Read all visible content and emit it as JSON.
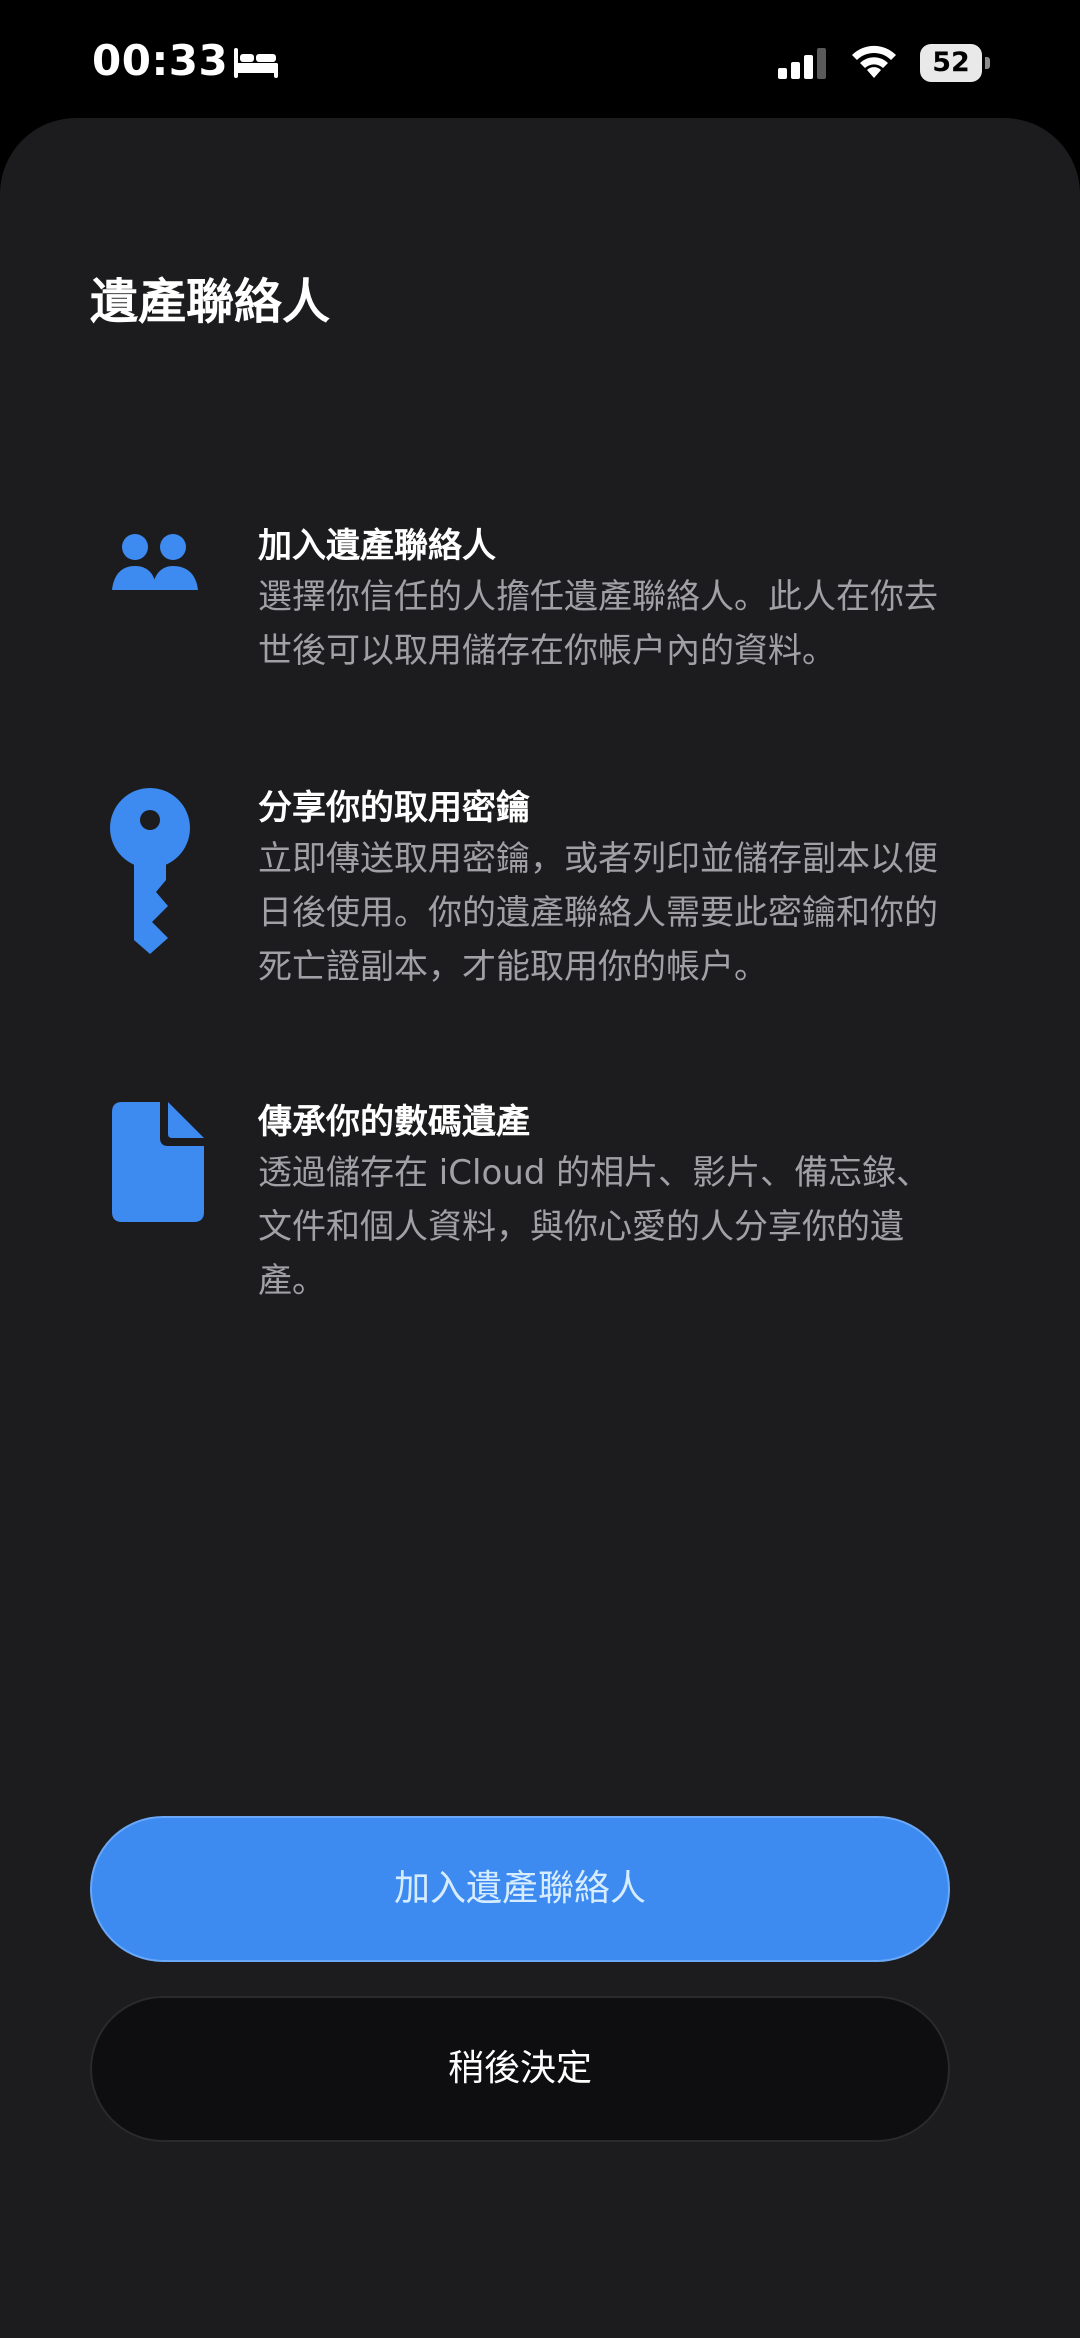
{
  "status_bar": {
    "time": "00:33",
    "battery_level": "52",
    "icons": [
      "bed-icon",
      "cellular-signal-icon",
      "wifi-icon",
      "battery-icon"
    ]
  },
  "sheet": {
    "title": "遺產聯絡人",
    "features": [
      {
        "icon": "people-icon",
        "title": "加入遺產聯絡人",
        "description": "選擇你信任的人擔任遺產聯絡人。此人在你去世後可以取用儲存在你帳户內的資料。"
      },
      {
        "icon": "key-icon",
        "title": "分享你的取用密鑰",
        "description": "立即傳送取用密鑰，或者列印並儲存副本以便日後使用。你的遺產聯絡人需要此密鑰和你的死亡證副本，才能取用你的帳户。"
      },
      {
        "icon": "document-icon",
        "title": "傳承你的數碼遺產",
        "description": "透過儲存在 iCloud 的相片、影片、備忘錄、文件和個人資料，與你心愛的人分享你的遺產。"
      }
    ],
    "primary_button": "加入遺產聯絡人",
    "secondary_button": "稍後決定"
  },
  "colors": {
    "accent": "#3d8af0",
    "sheet_background": "#1c1c1e",
    "secondary_text": "#a0a0a5"
  }
}
